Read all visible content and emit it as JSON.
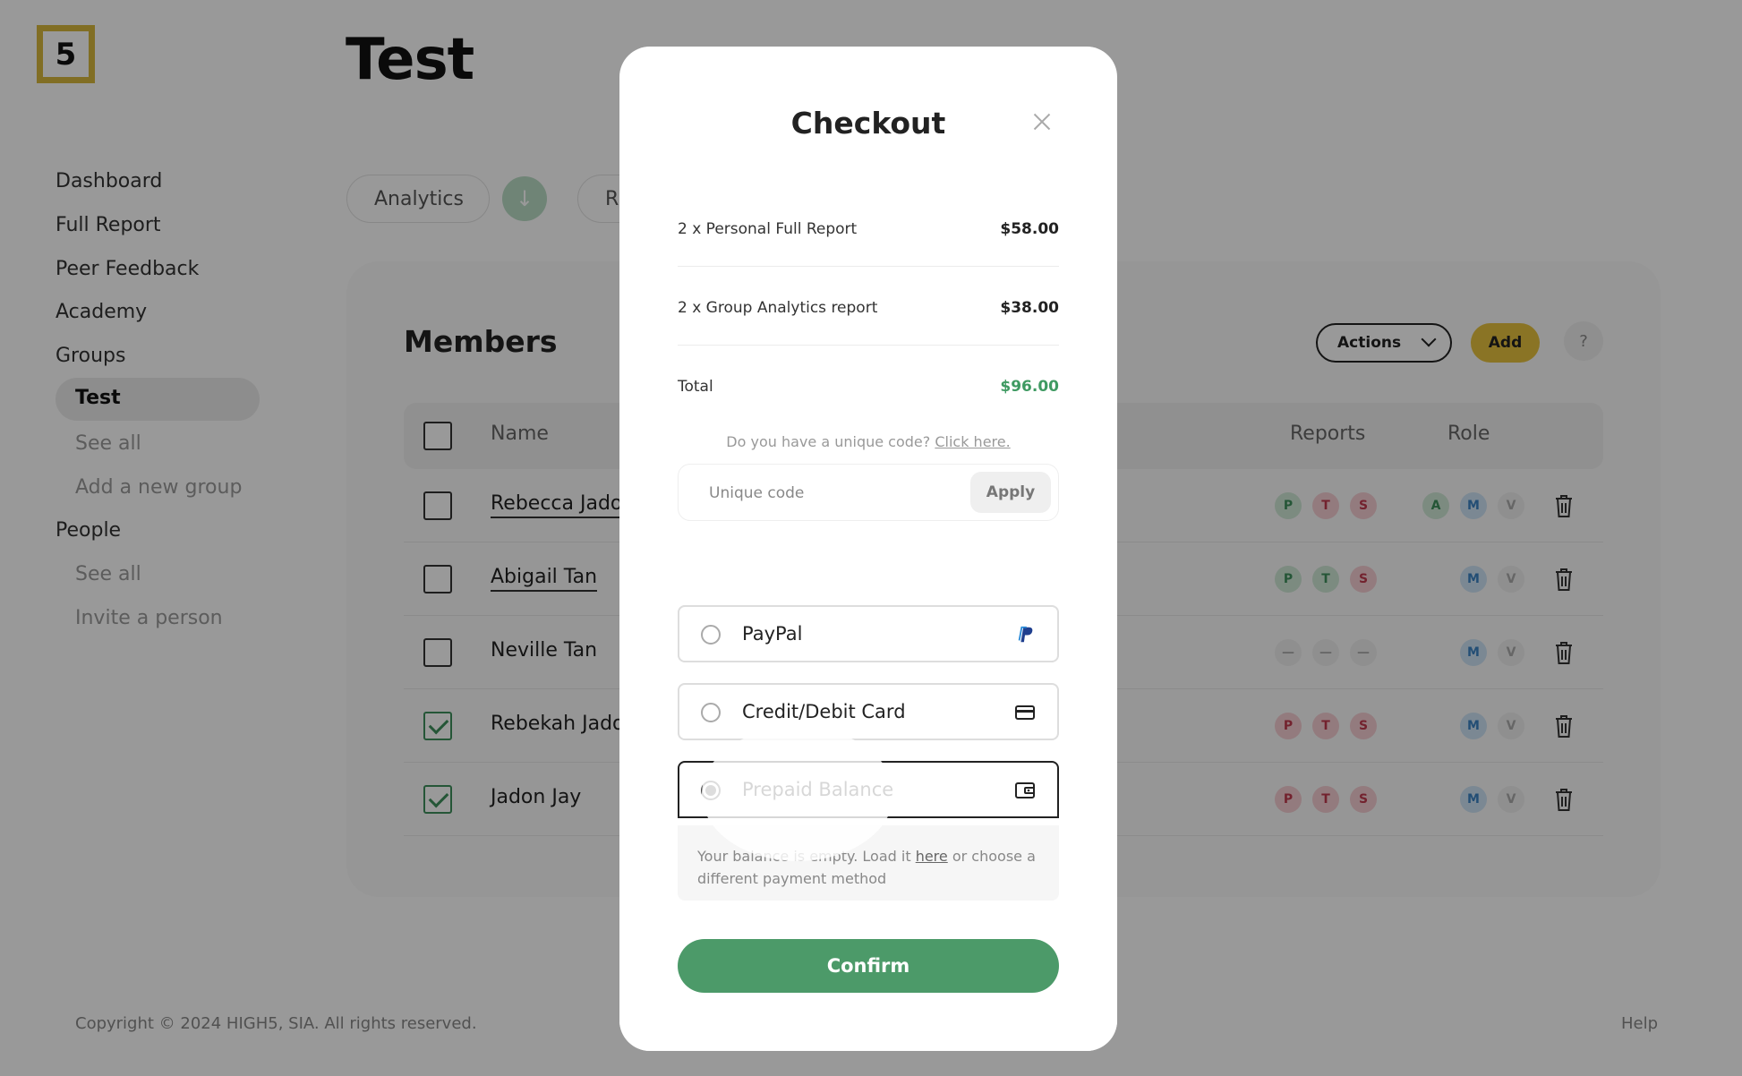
{
  "logo": {
    "text": "5"
  },
  "page": {
    "title": "Test"
  },
  "sidebar": {
    "items": [
      "Dashboard",
      "Full Report",
      "Peer Feedback",
      "Academy",
      "Groups"
    ],
    "active": "Test",
    "groups_sub": [
      "See all",
      "Add a new group"
    ],
    "people_label": "People",
    "people_sub": [
      "See all",
      "Invite a person"
    ]
  },
  "tabs": {
    "analytics": "Analytics",
    "reports": "R"
  },
  "members": {
    "title": "Members",
    "actions_label": "Actions",
    "add_label": "Add",
    "help_label": "?",
    "columns": {
      "name": "Name",
      "reports": "Reports",
      "role": "Role"
    },
    "rows": [
      {
        "name": "Rebecca Jado"
      },
      {
        "name": "Abigail Tan"
      },
      {
        "name": "Neville Tan"
      },
      {
        "name": "Rebekah Jado"
      },
      {
        "name": "Jadon Jay"
      }
    ],
    "badges": {
      "p": "P",
      "t": "T",
      "s": "S",
      "a": "A",
      "m": "M",
      "v": "V",
      "dash": "—"
    }
  },
  "footer": {
    "copyright": "Copyright © 2024 HIGH5, SIA. All rights reserved.",
    "help": "Help"
  },
  "checkout": {
    "title": "Checkout",
    "items": [
      {
        "label": "2 x Personal Full Report",
        "amount": "$58.00"
      },
      {
        "label": "2 x Group Analytics report",
        "amount": "$38.00"
      }
    ],
    "total_label": "Total",
    "total_amount": "$96.00",
    "code_prompt": "Do you have a unique code?",
    "code_link": "Click here.",
    "code_placeholder": "Unique code",
    "apply_label": "Apply",
    "payment_options": {
      "paypal": "PayPal",
      "card": "Credit/Debit Card",
      "prepaid": "Prepaid Balance"
    },
    "selected_option": "Prepaid Balance",
    "balance_note_1": "Your balance is empty. Load it",
    "balance_note_link": "here",
    "balance_note_2": "or choose a different payment method",
    "confirm_label": "Confirm"
  },
  "colors": {
    "accent_green": "#4c9a69",
    "brand_yellow": "#e6c13e",
    "total_green": "#3f9a62"
  }
}
